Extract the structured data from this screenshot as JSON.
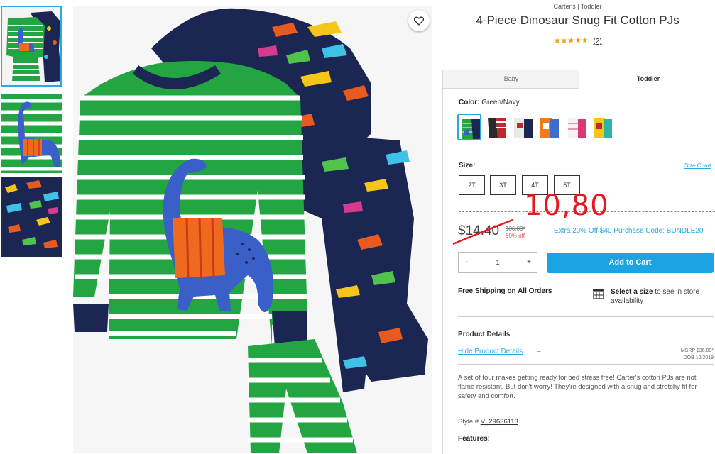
{
  "product": {
    "breadcrumb": "Carter's | Toddler",
    "title": "4-Piece Dinosaur Snug Fit Cotton PJs",
    "rating_stars": "★★★★★",
    "review_count": "(2)"
  },
  "tabs": [
    {
      "label": "Baby"
    },
    {
      "label": "Toddler"
    }
  ],
  "color": {
    "label": "Color:",
    "value": "Green/Navy"
  },
  "size": {
    "label": "Size:",
    "chart_link": "Size Chart",
    "options": [
      {
        "label": "2T"
      },
      {
        "label": "3T"
      },
      {
        "label": "4T"
      },
      {
        "label": "5T"
      }
    ]
  },
  "pricing": {
    "price": "$14.40",
    "original": "$36.00*",
    "percent_off": "60% off",
    "handwritten_annotation": "10,80",
    "promo": "Extra 20% Off $40 Purchase Code: BUNDLE20"
  },
  "quantity": {
    "minus": "-",
    "value": "1",
    "plus": "+"
  },
  "add_to_cart": "Add to Cart",
  "shipping": "Free Shipping on All Orders",
  "store": {
    "bold": "Select a size",
    "rest": " to see in store availability"
  },
  "details": {
    "heading": "Product Details",
    "hide_link": "Hide Product Details",
    "dash": "–",
    "msrp": "MSRP $36.00*",
    "dob": "DOB 10/2019",
    "description": "A set of four makes getting ready for bed stress free! Carter's cotton PJs are not flame resistant. But don't worry! They're designed with a snug and stretchy fit for safety and comfort.",
    "style_label": "Style # ",
    "style_number": "V_29636113",
    "features": "Features:"
  },
  "colors": {
    "accent": "#29a9e1",
    "cart_button": "#1ba3e4",
    "annotation": "#e8171f"
  }
}
